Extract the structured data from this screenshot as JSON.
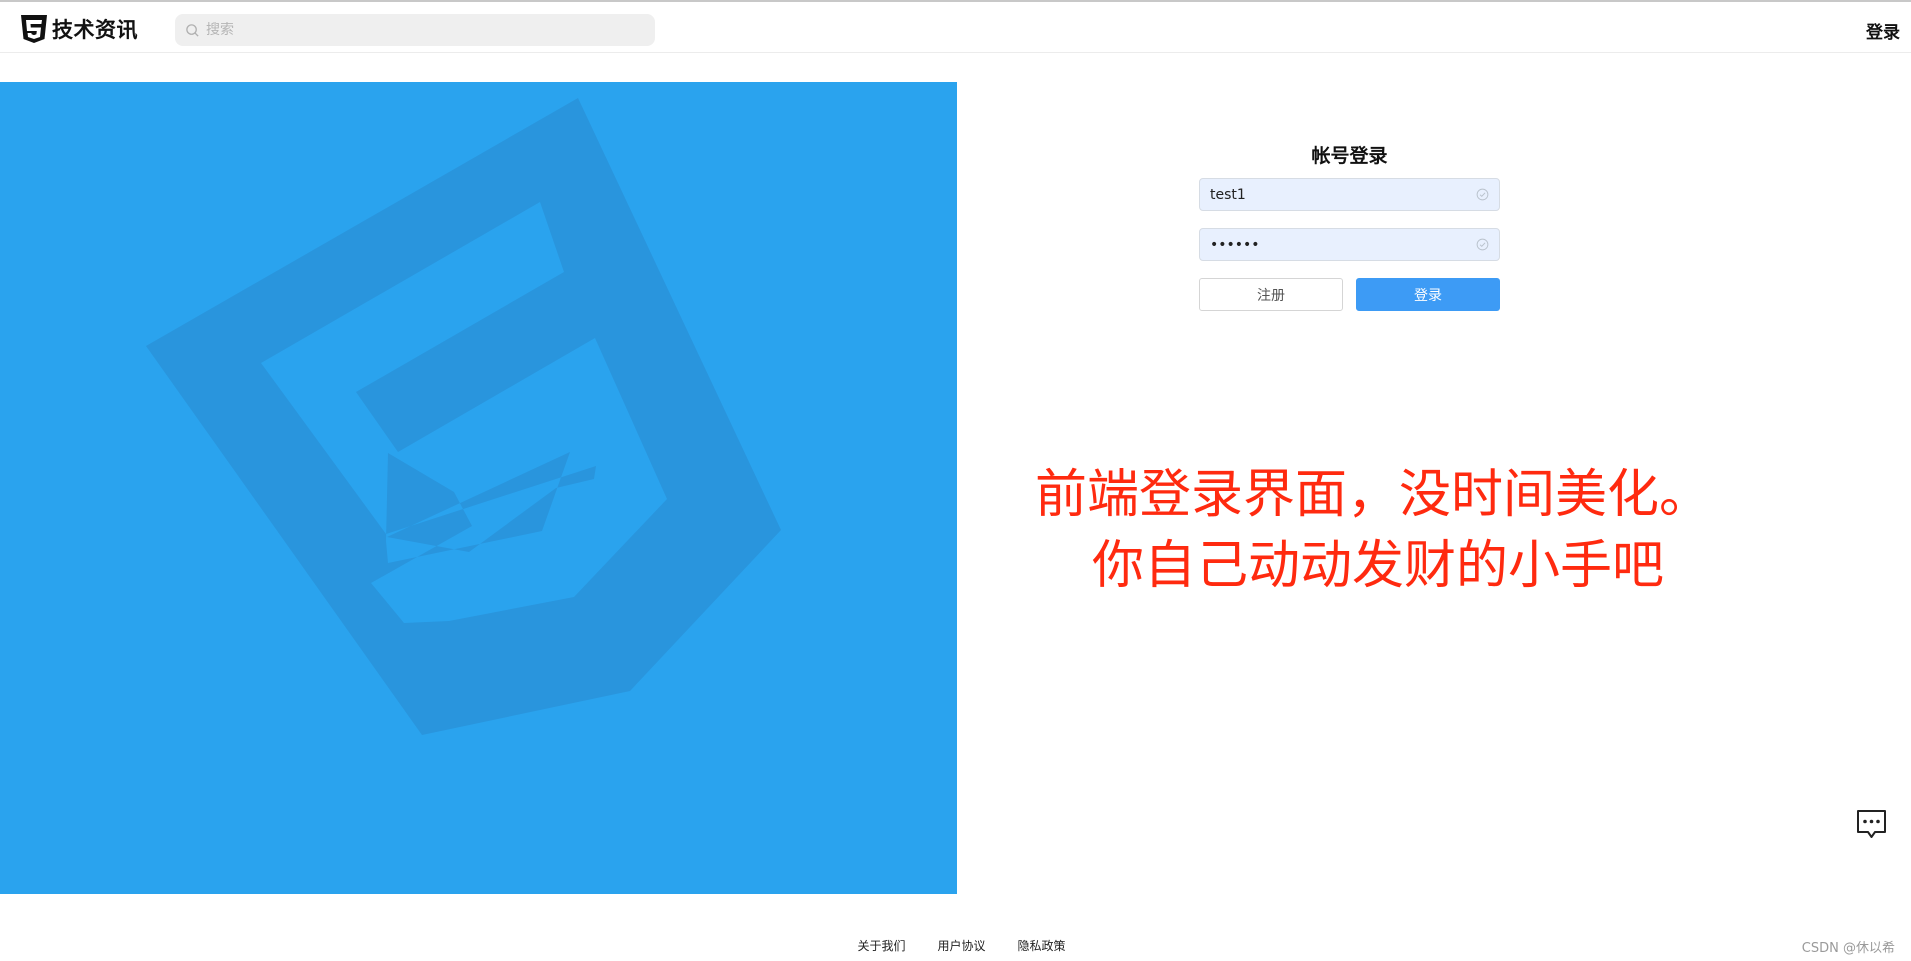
{
  "header": {
    "site_name": "技术资讯",
    "logo_icon": "html5-shield-icon",
    "search_placeholder": "搜索",
    "search_icon": "search-icon",
    "login_link": "登录"
  },
  "hero": {
    "background_color": "#2aa3ee",
    "emblem_color": "#2995dd",
    "emblem_icon": "css3-shield-icon"
  },
  "login_form": {
    "title": "帐号登录",
    "username_value": "test1",
    "password_value": "••••••",
    "register_label": "注册",
    "login_label": "登录",
    "accent_color": "#3d9bf5"
  },
  "annotation": {
    "line1": "前端登录界面，没时间美化。",
    "line2": "你自己动动发财的小手吧",
    "color": "#ff2a0f"
  },
  "chat_icon": "chat-bubble-icon",
  "footer": {
    "links": [
      "关于我们",
      "用户协议",
      "隐私政策"
    ],
    "watermark": "CSDN @休以希"
  }
}
